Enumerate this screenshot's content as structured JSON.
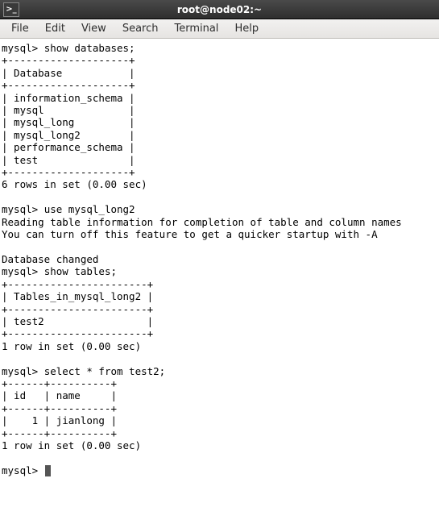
{
  "titlebar": {
    "title": "root@node02:~",
    "icon_glyph": ">_"
  },
  "menubar": {
    "items": [
      {
        "label": "File"
      },
      {
        "label": "Edit"
      },
      {
        "label": "View"
      },
      {
        "label": "Search"
      },
      {
        "label": "Terminal"
      },
      {
        "label": "Help"
      }
    ]
  },
  "terminal": {
    "prompt": "mysql>",
    "session": {
      "cmd1": "show databases;",
      "databases_header_sep": "+--------------------+",
      "databases_header": "| Database           |",
      "databases": [
        "| information_schema |",
        "| mysql              |",
        "| mysql_long         |",
        "| mysql_long2        |",
        "| performance_schema |",
        "| test               |"
      ],
      "databases_footer": "6 rows in set (0.00 sec)",
      "cmd2": "use mysql_long2",
      "cmd2_out1": "Reading table information for completion of table and column names",
      "cmd2_out2": "You can turn off this feature to get a quicker startup with -A",
      "cmd2_out3": "Database changed",
      "cmd3": "show tables;",
      "tables_header_sep": "+-----------------------+",
      "tables_header": "| Tables_in_mysql_long2 |",
      "tables": [
        "| test2                 |"
      ],
      "tables_footer": "1 row in set (0.00 sec)",
      "cmd4": "select * from test2;",
      "test2_sep": "+------+----------+",
      "test2_header": "| id   | name     |",
      "test2_rows": [
        "|    1 | jianlong |"
      ],
      "test2_footer": "1 row in set (0.00 sec)"
    }
  }
}
